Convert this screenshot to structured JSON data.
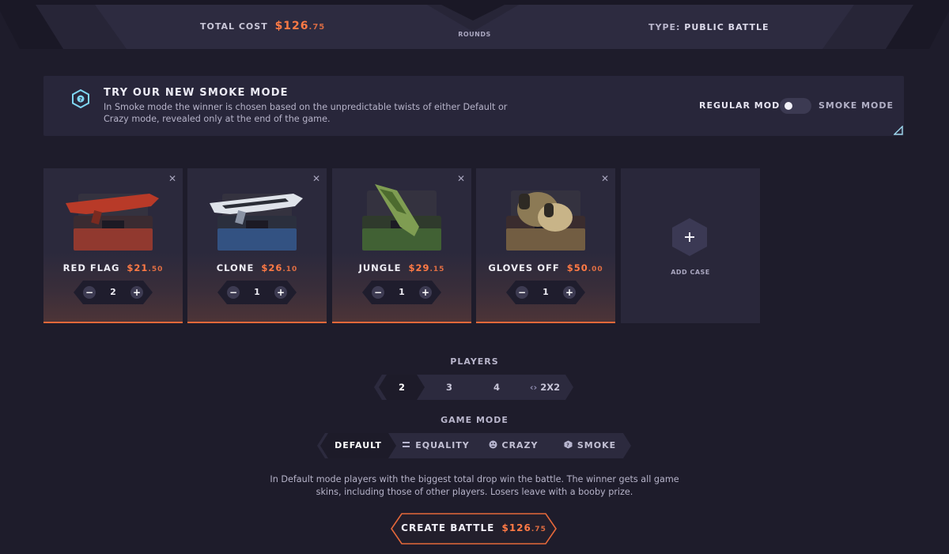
{
  "header": {
    "total_cost_label": "TOTAL COST",
    "total_cost_main": "$126",
    "total_cost_cents": ".75",
    "rounds_label": "ROUNDS",
    "type_label": "TYPE:",
    "type_value": "PUBLIC BATTLE"
  },
  "smoke_banner": {
    "title": "TRY OUR NEW SMOKE MODE",
    "description": "In Smoke mode the winner is chosen based on the unpredictable twists of either Default or Crazy mode, revealed only at the end of the game.",
    "regular_label": "REGULAR MODE",
    "smoke_label": "SMOKE MODE",
    "smoke_enabled": false
  },
  "cases": [
    {
      "name": "RED FLAG",
      "price_main": "$21",
      "price_cents": ".50",
      "quantity": "2",
      "accent": "#d8452e"
    },
    {
      "name": "CLONE",
      "price_main": "$26",
      "price_cents": ".10",
      "quantity": "1",
      "accent": "#3f7fd6"
    },
    {
      "name": "JUNGLE",
      "price_main": "$29",
      "price_cents": ".15",
      "quantity": "1",
      "accent": "#4f7b3a"
    },
    {
      "name": "GLOVES OFF",
      "price_main": "$50",
      "price_cents": ".00",
      "quantity": "1",
      "accent": "#b89a5a"
    }
  ],
  "add_case": {
    "label": "ADD CASE",
    "icon": "plus-icon"
  },
  "players": {
    "label": "PLAYERS",
    "options": [
      "2",
      "3",
      "4",
      "2X2"
    ],
    "selected": "2"
  },
  "game_mode": {
    "label": "GAME MODE",
    "options": [
      "DEFAULT",
      "EQUALITY",
      "CRAZY",
      "SMOKE"
    ],
    "selected": "DEFAULT",
    "description": "In Default mode players with the biggest total drop win the battle. The winner gets all game skins, including those of other players. Losers leave with a booby prize."
  },
  "create_button": {
    "label": "CREATE BATTLE",
    "price_main": "$126",
    "price_cents": ".75"
  },
  "colors": {
    "accent": "#ff7a45",
    "background": "#1e1c2b",
    "panel": "#28263a"
  }
}
